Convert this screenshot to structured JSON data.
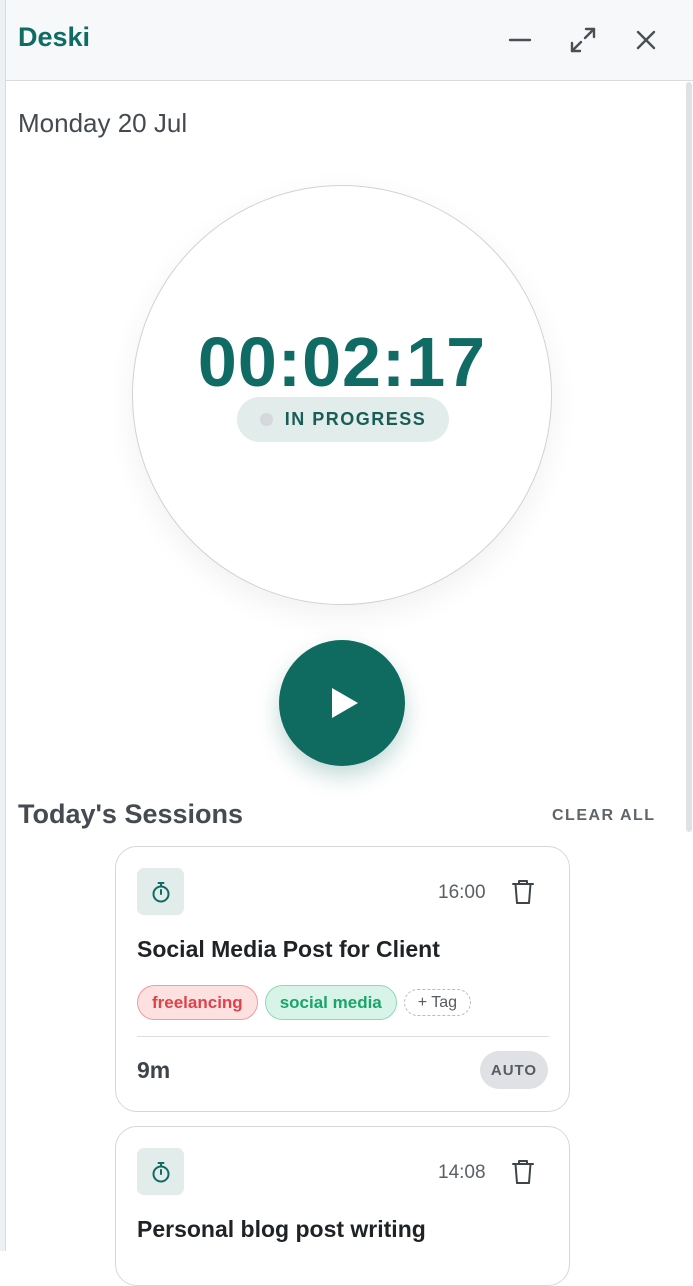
{
  "app": {
    "title": "Deski"
  },
  "window_controls": {
    "minimize": "minimize-icon",
    "maximize": "maximize-icon",
    "close": "close-icon"
  },
  "date": "Monday 20 Jul",
  "timer": {
    "elapsed": "00:02:17",
    "status": "IN PROGRESS",
    "action": "play-icon"
  },
  "sessions": {
    "title": "Today's Sessions",
    "clear_all": "CLEAR ALL",
    "items": [
      {
        "time": "16:00",
        "title": "Social Media Post for Client",
        "tags": [
          "freelancing",
          "social media"
        ],
        "add_tag": "+ Tag",
        "duration": "9m",
        "mode": "AUTO"
      },
      {
        "time": "14:08",
        "title": "Personal blog post writing"
      }
    ]
  },
  "colors": {
    "brand": "#0f6b63",
    "play_button": "#0f6b5f",
    "tag_red": "#e0424a",
    "tag_green": "#18a56a"
  }
}
